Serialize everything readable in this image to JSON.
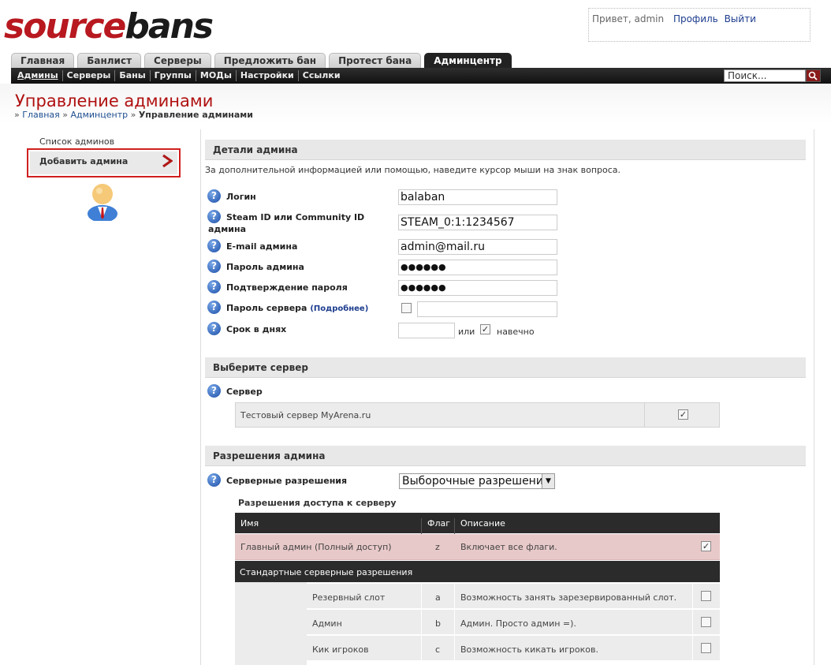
{
  "logo": {
    "part1": "source",
    "part2": "bans"
  },
  "user": {
    "greeting": "Привет, admin",
    "profile": "Профиль",
    "logout": "Выйти"
  },
  "tabs": [
    "Главная",
    "Банлист",
    "Серверы",
    "Предложить бан",
    "Протест бана",
    "Админцентр"
  ],
  "active_tab": "Админцентр",
  "subnav": [
    "Админы",
    "Серверы",
    "Баны",
    "Группы",
    "МОДы",
    "Настройки",
    "Ссылки"
  ],
  "search": {
    "value": "Поиск..."
  },
  "page": {
    "title": "Управление админами",
    "breadcrumb": {
      "home": "Главная",
      "admin": "Админцентр",
      "current": "Управление админами"
    }
  },
  "sidebar": {
    "list_link": "Список админов",
    "add_link": "Добавить админа"
  },
  "details": {
    "title": "Детали админа",
    "hint": "За дополнительной информацией или помощью, наведите курсор мыши на знак вопроса.",
    "login_label": "Логин",
    "login_value": "balaban",
    "steam_label_1": "Steam ID или Community ID",
    "steam_label_2": "админа",
    "steam_value": "STEAM_0:1:1234567",
    "email_label": "E-mail админа",
    "email_value": "admin@mail.ru",
    "password_label": "Пароль админа",
    "password_value": "●●●●●●",
    "confirm_label": "Подтверждение пароля",
    "confirm_value": "●●●●●●",
    "server_pw_label": "Пароль сервера",
    "server_pw_more": "(Подробнее)",
    "server_pw_checked": false,
    "days_label": "Срок в днях",
    "days_or": "или",
    "days_forever": "навечно",
    "days_forever_checked": true
  },
  "server_section": {
    "title": "Выберите сервер",
    "label": "Сервер",
    "server_name": "Тестовый сервер MyArena.ru",
    "checked": true
  },
  "perm_section": {
    "title": "Разрешения админа",
    "label": "Серверные разрешения",
    "select_value": "Выборочные разрешения",
    "subhead": "Разрешения доступа к серверу",
    "headers": {
      "name": "Имя",
      "flag": "Флаг",
      "desc": "Описание"
    },
    "root": {
      "name": "Главный админ (Полный доступ)",
      "flag": "z",
      "desc": "Включает все флаги.",
      "checked": true
    },
    "group_title": "Стандартные серверные разрешения",
    "rows": [
      {
        "name": "Резервный слот",
        "flag": "a",
        "desc": "Возможность занять зарезервированный слот.",
        "checked": false
      },
      {
        "name": "Админ",
        "flag": "b",
        "desc": "Админ. Просто админ =).",
        "checked": false
      },
      {
        "name": "Кик игроков",
        "flag": "c",
        "desc": "Возможность кикать игроков.",
        "checked": false
      }
    ]
  }
}
